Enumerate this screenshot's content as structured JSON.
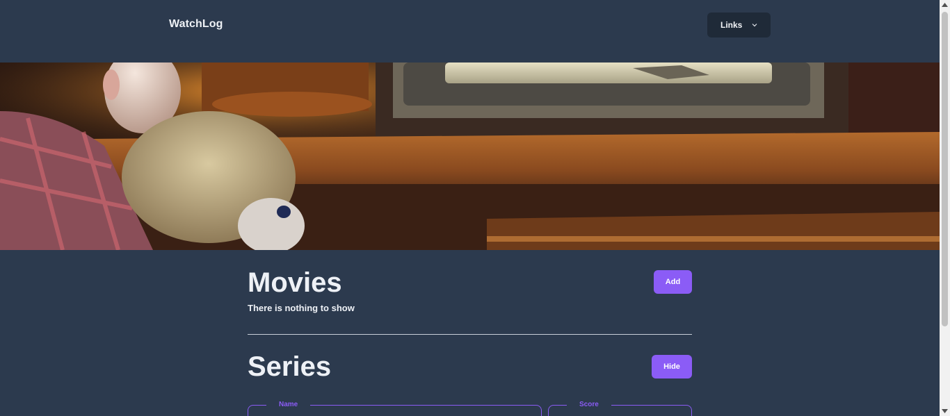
{
  "header": {
    "brand": "WatchLog",
    "links_label": "Links",
    "links_icon": "chevron-down-icon"
  },
  "hero": {
    "description_icon": "hero-image"
  },
  "movies": {
    "title": "Movies",
    "add_label": "Add",
    "empty_text": "There is nothing to show"
  },
  "series": {
    "title": "Series",
    "hide_label": "Hide",
    "name_label": "Name",
    "score_label": "Score"
  },
  "colors": {
    "background": "#2c3a4e",
    "accent": "#8b5cf6",
    "dropdown_bg": "#1f2a38"
  }
}
